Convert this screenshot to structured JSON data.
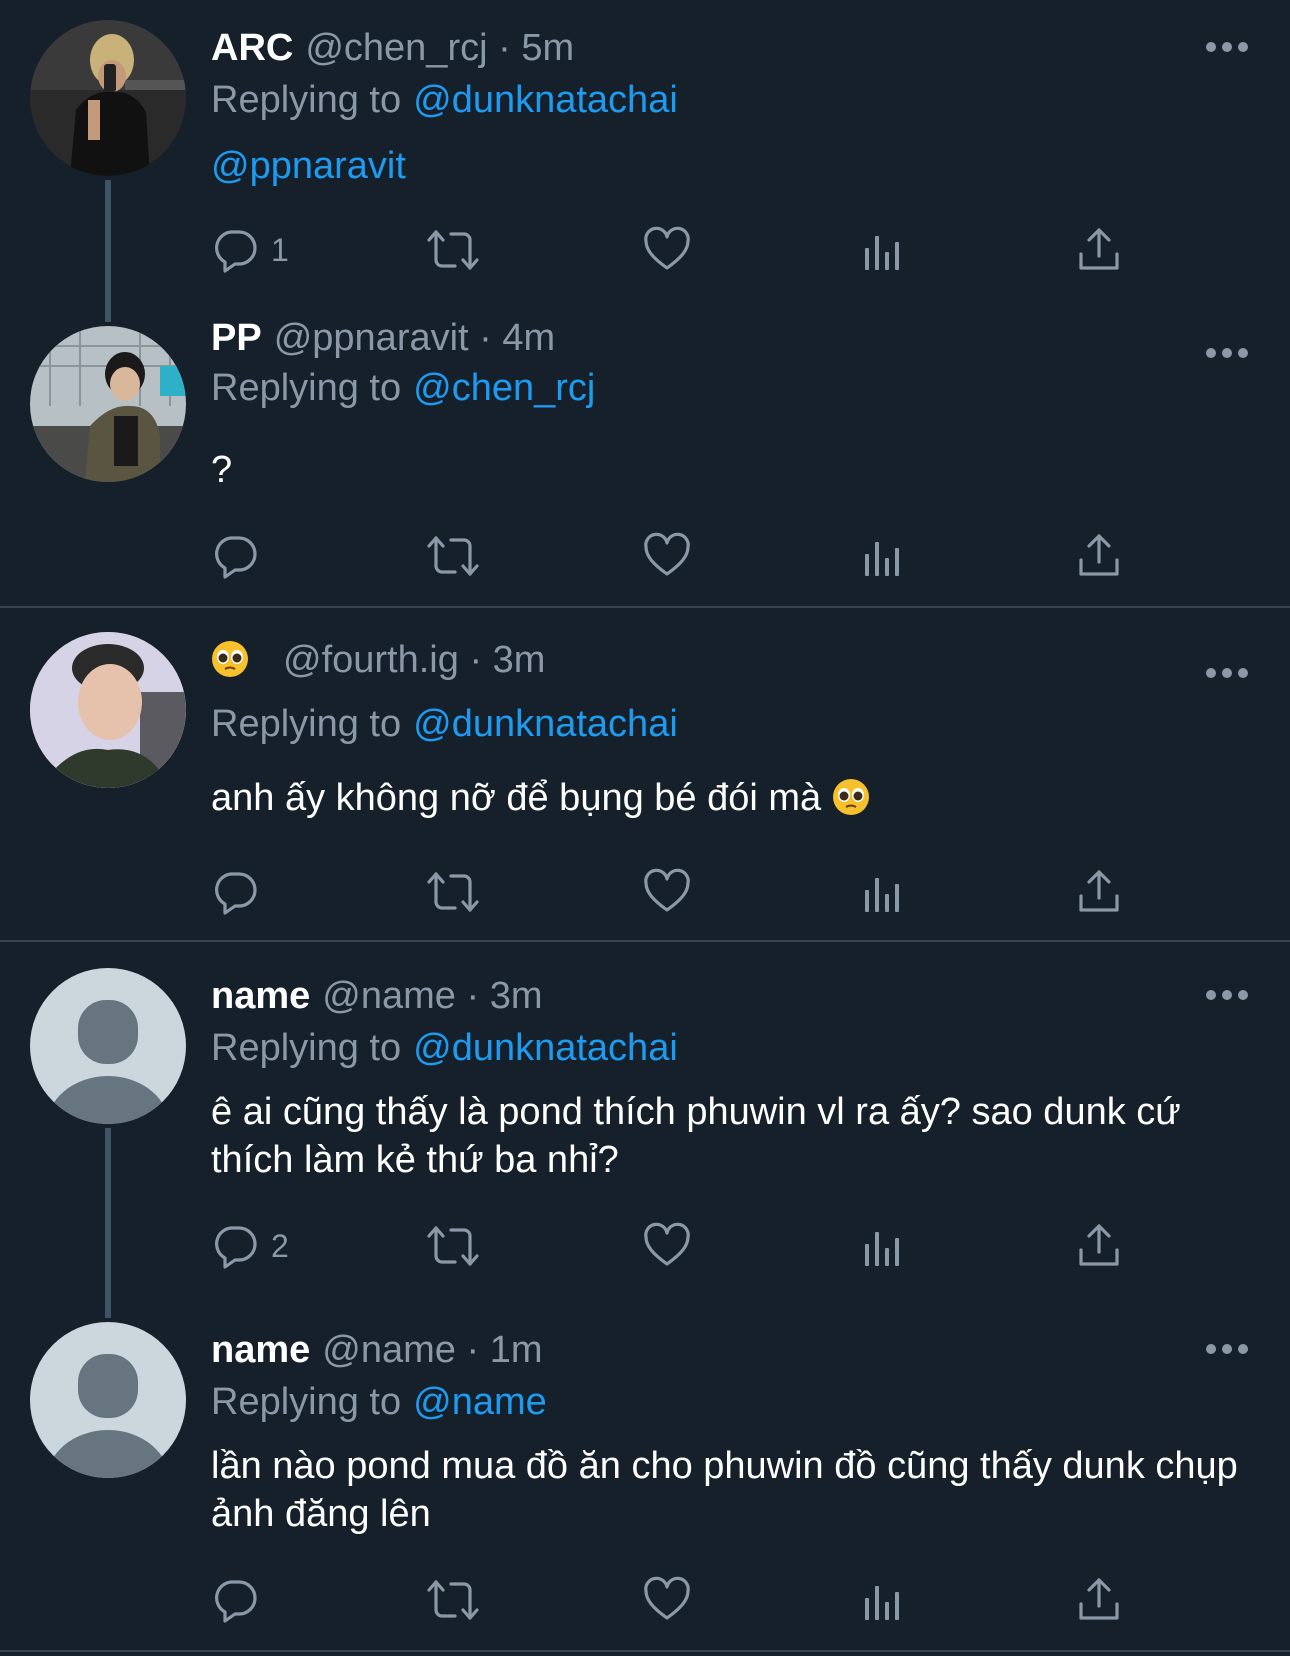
{
  "tweets": [
    {
      "name": "ARC",
      "handle": "@chen_rcj",
      "time": "· 5m",
      "replying_label": "Replying to",
      "replying_to": "@dunknatachai",
      "text": "@ppnaravit",
      "reply_count": "1",
      "avatar": "photo-man-mirror-selfie"
    },
    {
      "name": "PP",
      "handle": "@ppnaravit",
      "time": "· 4m",
      "replying_label": "Replying to",
      "replying_to": "@chen_rcj",
      "text": "?",
      "reply_count": "",
      "avatar": "photo-man-airport"
    },
    {
      "name": "",
      "name_emoji": "pleading-face-emoji",
      "handle": "@fourth.ig",
      "time": "· 3m",
      "replying_label": "Replying to",
      "replying_to": "@dunknatachai",
      "text": "anh ấy không nỡ để bụng bé đói mà",
      "text_emoji": "pleading-face-emoji",
      "reply_count": "",
      "avatar": "photo-young-man-portrait"
    },
    {
      "name": "name",
      "handle": "@name",
      "time": "· 3m",
      "replying_label": "Replying to",
      "replying_to": "@dunknatachai",
      "text": "ê ai cũng thấy là pond thích phuwin vl ra ấy? sao dunk cứ thích làm kẻ thứ ba nhỉ?",
      "reply_count": "2",
      "avatar": "default-profile-placeholder"
    },
    {
      "name": "name",
      "handle": "@name",
      "time": "· 1m",
      "replying_label": "Replying to",
      "replying_to": "@name",
      "text": "lần nào pond mua đồ ăn cho phuwin đồ cũng thấy dunk chụp ảnh đăng lên",
      "reply_count": "",
      "avatar": "default-profile-placeholder"
    }
  ],
  "colors": {
    "background": "#15202b",
    "link": "#1d9bf0",
    "secondary_text": "#8b98a5",
    "icon": "#8b98a5",
    "divider": "#38444d",
    "thread_line": "#3d5466"
  }
}
